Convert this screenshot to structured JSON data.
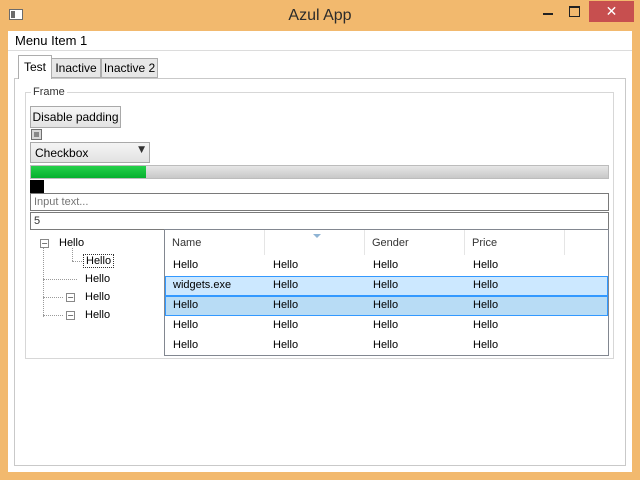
{
  "window": {
    "title": "Azul App",
    "close_glyph": "✕"
  },
  "menu": {
    "items": [
      {
        "label": "Menu Item 1"
      }
    ]
  },
  "tabs": [
    {
      "label": "Test"
    },
    {
      "label": "Inactive"
    },
    {
      "label": "Inactive 2"
    }
  ],
  "frame": {
    "title": "Frame",
    "disable_padding_label": "Disable padding",
    "checkbox_checked": false,
    "combo": {
      "selected": "Checkbox",
      "arrow_glyph": "▼"
    },
    "progress": {
      "value": 0.2
    },
    "input_text": {
      "placeholder": "Input text..."
    },
    "number_input": {
      "value": "5"
    }
  },
  "tree": {
    "expander_glyph": "−",
    "nodes": [
      {
        "label": "Hello",
        "level": 0,
        "expanded": true
      },
      {
        "label": "Hello",
        "level": 1,
        "selected": true
      },
      {
        "label": "Hello",
        "level": 1
      },
      {
        "label": "Hello",
        "level": 1,
        "expanded": true
      },
      {
        "label": "Hello",
        "level": 1,
        "expanded": true
      }
    ]
  },
  "grid": {
    "headers": [
      "Name",
      "",
      "Gender",
      "Price"
    ],
    "rows": [
      [
        "Hello",
        "Hello",
        "Hello",
        "Hello"
      ],
      [
        "widgets.exe",
        "Hello",
        "Hello",
        "Hello"
      ],
      [
        "Hello",
        "Hello",
        "Hello",
        "Hello"
      ],
      [
        "Hello",
        "Hello",
        "Hello",
        "Hello"
      ],
      [
        "Hello",
        "Hello",
        "Hello",
        "Hello"
      ]
    ]
  },
  "colors": {
    "titlebar": "#f2b96e",
    "close": "#c74f4f",
    "progress": "#06b02e",
    "selection": "#cce8ff"
  }
}
